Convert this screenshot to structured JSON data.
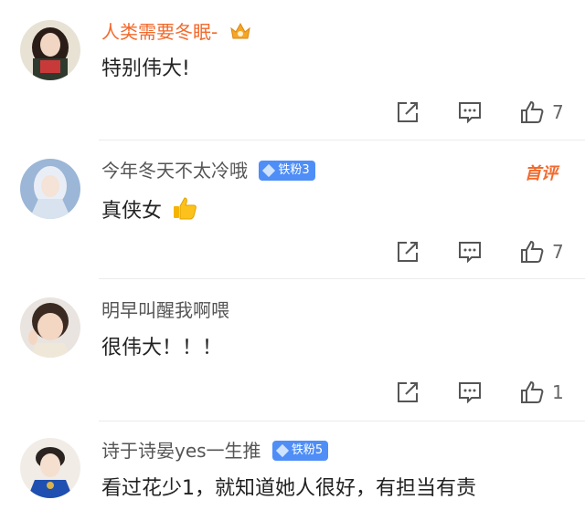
{
  "colors": {
    "vip_name": "#f26a2d",
    "normal_name": "#555555",
    "badge_bg": "#4f8ef7",
    "first_tag": "#f26a2d"
  },
  "comments": [
    {
      "username": "人类需要冬眠-",
      "name_color": "#f26a2d",
      "has_crown": true,
      "badge": "",
      "text": "特别伟大!",
      "emoji": "",
      "likes": "7",
      "first_tag": ""
    },
    {
      "username": "今年冬天不太冷哦",
      "name_color": "#555555",
      "has_crown": false,
      "badge": "铁粉3",
      "text": "真侠女",
      "emoji": "thumbs-up",
      "likes": "7",
      "first_tag": "首评"
    },
    {
      "username": "明早叫醒我啊喂",
      "name_color": "#555555",
      "has_crown": false,
      "badge": "",
      "text": "很伟大！！！",
      "emoji": "",
      "likes": "1",
      "first_tag": ""
    },
    {
      "username": "诗于诗晏yes一生推",
      "name_color": "#555555",
      "has_crown": false,
      "badge": "铁粉5",
      "text": "看过花少1，就知道她人很好，有担当有责",
      "emoji": "",
      "likes": "",
      "first_tag": ""
    }
  ],
  "icons": {
    "share": "share-icon",
    "comment": "comment-icon",
    "like": "like-icon"
  }
}
